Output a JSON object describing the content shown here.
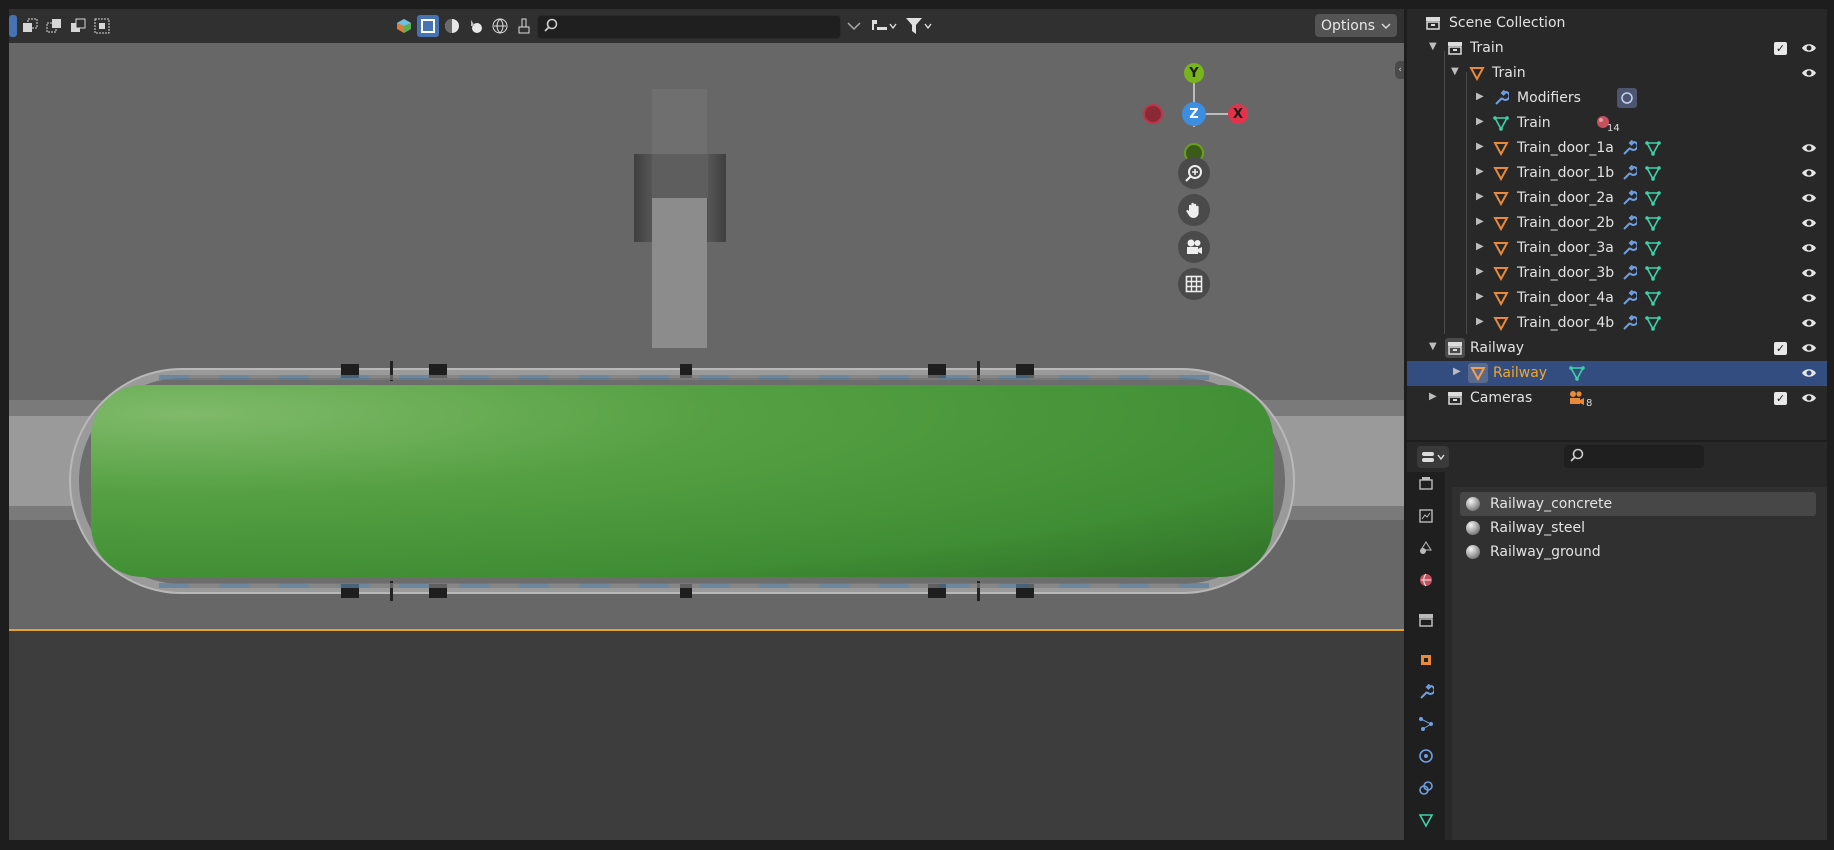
{
  "viewport": {
    "options_label": "Options",
    "search_placeholder": "",
    "axis_labels": {
      "y": "Y",
      "z": "Z",
      "x": "X"
    }
  },
  "outliner": {
    "scene_collection": "Scene Collection",
    "rows": {
      "train_collection": "Train",
      "train_object": "Train",
      "modifiers": "Modifiers",
      "train_mesh": "Train",
      "train_mesh_count": "14",
      "doors": [
        "Train_door_1a",
        "Train_door_1b",
        "Train_door_2a",
        "Train_door_2b",
        "Train_door_3a",
        "Train_door_3b",
        "Train_door_4a",
        "Train_door_4b"
      ],
      "railway_collection": "Railway",
      "railway_object": "Railway",
      "cameras_collection": "Cameras",
      "cameras_count": "8"
    }
  },
  "properties": {
    "search_placeholder": "",
    "materials": [
      "Railway_concrete",
      "Railway_steel",
      "Railway_ground"
    ]
  },
  "colors": {
    "selection": "#334d80",
    "active_object_text": "#f5a623",
    "mesh_green": "#4a9c3f",
    "axis_x": "#e3334b",
    "axis_y": "#78b51b",
    "axis_z": "#3d8de0",
    "orange_outline": "#e3a13a"
  },
  "icons": [
    "select-box-icon",
    "viewport-shading-icon",
    "eye-icon",
    "wrench-icon",
    "mesh-data-icon",
    "mesh-object-icon",
    "camera-icon",
    "material-icon",
    "filter-icon"
  ]
}
